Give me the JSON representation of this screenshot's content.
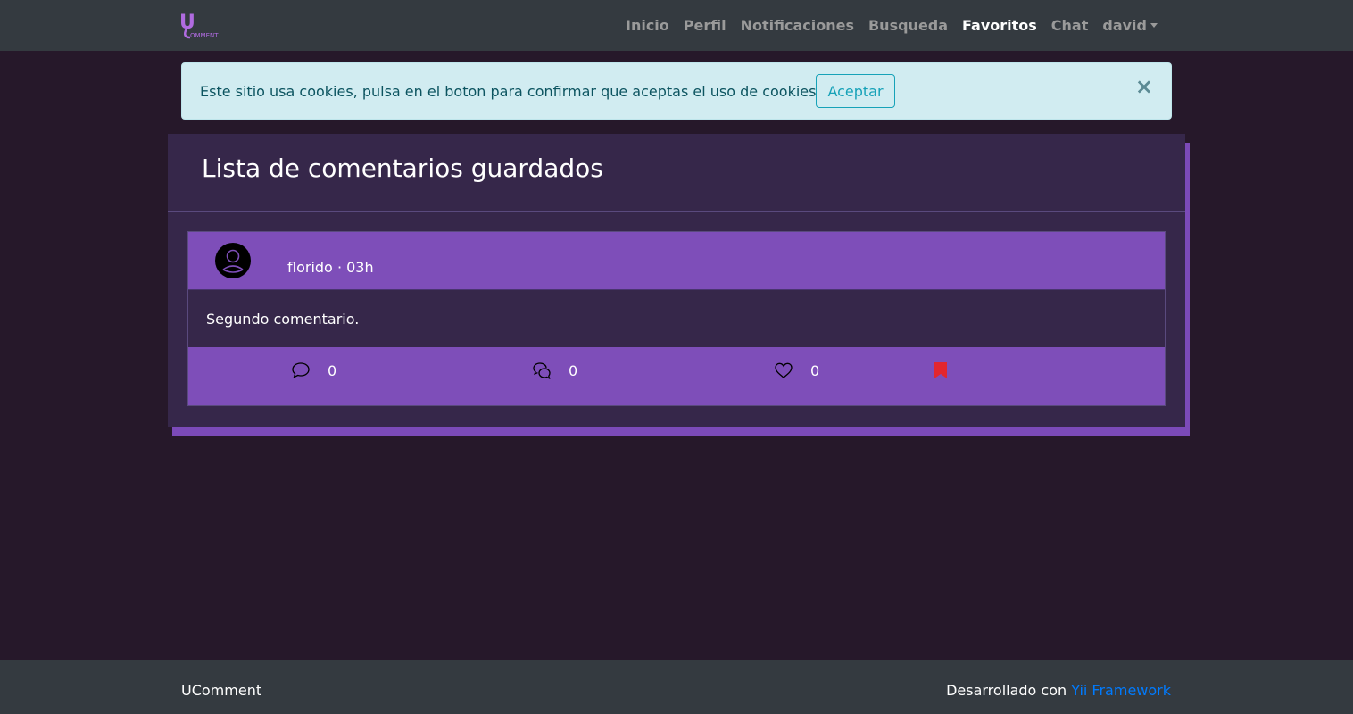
{
  "brand": {
    "logo_big": "U",
    "logo_small": "OMMENT"
  },
  "nav": {
    "items": [
      {
        "label": "Inicio",
        "active": false
      },
      {
        "label": "Perfil",
        "active": false
      },
      {
        "label": "Notificaciones",
        "active": false
      },
      {
        "label": "Busqueda",
        "active": false
      },
      {
        "label": "Favoritos",
        "active": true
      },
      {
        "label": "Chat",
        "active": false
      }
    ],
    "user": "david"
  },
  "cookie_alert": {
    "message": "Este sitio usa cookies, pulsa en el boton para confirmar que aceptas el uso de cookies",
    "accept_label": "Aceptar",
    "close_symbol": "×"
  },
  "page": {
    "title": "Lista de comentarios guardados"
  },
  "comments": [
    {
      "author": "florido",
      "separator": "·",
      "time": "03h",
      "text": "Segundo comentario.",
      "actions": {
        "replies": {
          "icon": "comment-icon",
          "count": "0"
        },
        "quotes": {
          "icon": "comments-icon",
          "count": "0"
        },
        "likes": {
          "icon": "heart-icon",
          "count": "0"
        },
        "saved": {
          "icon": "bookmark-icon",
          "active": true
        }
      }
    }
  ],
  "footer": {
    "brand": "UComment",
    "credit_prefix": "Desarrollado con",
    "credit_link": "Yii Framework"
  },
  "colors": {
    "navbar": "#343a40",
    "background": "#26182a",
    "card": "#36274a",
    "accent_purple": "#7e4eb9",
    "bookmark": "#e3262e",
    "link": "#007bff",
    "alert_bg": "#d1ecf1"
  }
}
